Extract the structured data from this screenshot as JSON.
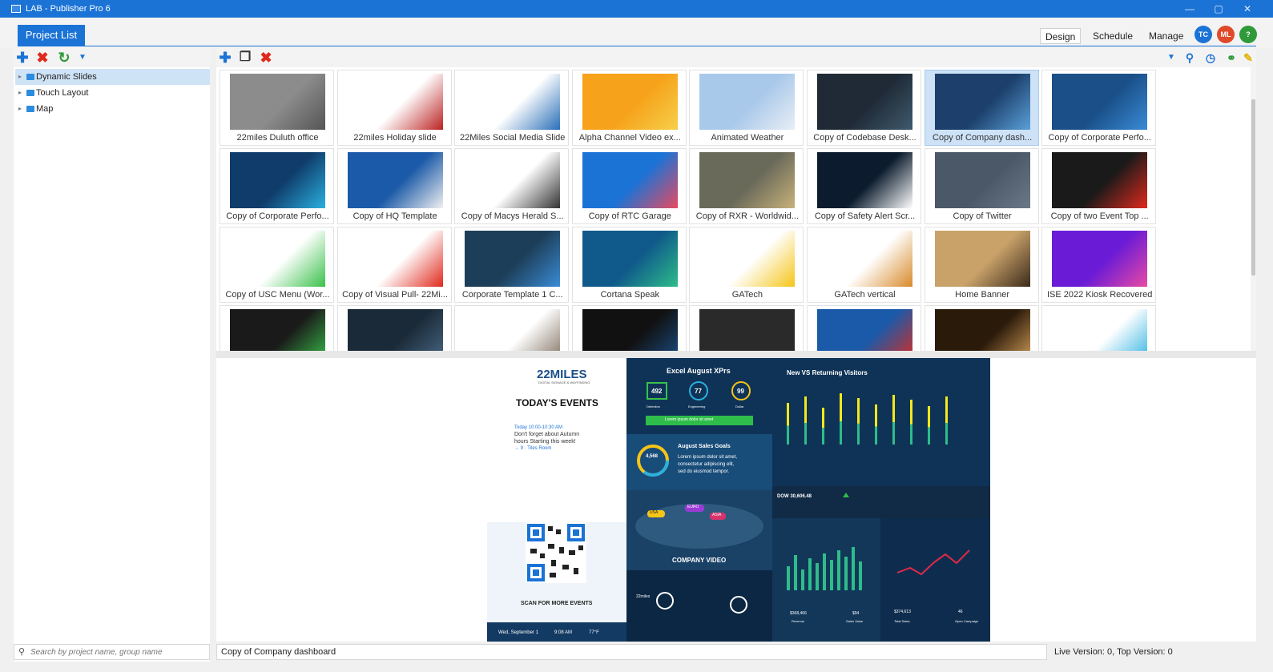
{
  "window": {
    "title": "LAB - Publisher Pro 6",
    "min": "—",
    "max": "▢",
    "close": "✕"
  },
  "topnav": {
    "project_tab": "Project List",
    "buttons": [
      {
        "label": "Design",
        "active": true
      },
      {
        "label": "Schedule"
      },
      {
        "label": "Manage"
      }
    ],
    "avatars": [
      {
        "initials": "TC",
        "color": "#1b73d6"
      },
      {
        "initials": "ML",
        "color": "#e04a2a"
      },
      {
        "initials": "?",
        "color": "#2e9a3a"
      }
    ]
  },
  "tree": {
    "items": [
      {
        "label": "Dynamic Slides",
        "selected": true
      },
      {
        "label": "Touch Layout"
      },
      {
        "label": "Map"
      }
    ]
  },
  "search": {
    "placeholder": "Search by project name, group name"
  },
  "projects": [
    {
      "name": "22miles Duluth office"
    },
    {
      "name": "22miles Holiday slide"
    },
    {
      "name": "22Miles Social Media Slide"
    },
    {
      "name": "Alpha Channel Video ex..."
    },
    {
      "name": "Animated Weather"
    },
    {
      "name": "Copy of Codebase Desk..."
    },
    {
      "name": "Copy of Company dash...",
      "selected": true
    },
    {
      "name": "Copy of Corporate Perfo..."
    },
    {
      "name": "Copy of Corporate Perfo..."
    },
    {
      "name": "Copy of HQ Template"
    },
    {
      "name": "Copy of Macys Herald S..."
    },
    {
      "name": "Copy of RTC Garage"
    },
    {
      "name": "Copy of RXR - Worldwid..."
    },
    {
      "name": "Copy of Safety Alert Scr..."
    },
    {
      "name": "Copy of Twitter"
    },
    {
      "name": "Copy of two Event Top ..."
    },
    {
      "name": "Copy of USC Menu (Wor..."
    },
    {
      "name": "Copy of Visual Pull- 22Mi..."
    },
    {
      "name": "Corporate Template 1 C..."
    },
    {
      "name": "Cortana Speak"
    },
    {
      "name": "GATech"
    },
    {
      "name": "GATech vertical"
    },
    {
      "name": "Home Banner"
    },
    {
      "name": "ISE 2022 Kiosk Recovered"
    },
    {
      "name": ""
    },
    {
      "name": ""
    },
    {
      "name": ""
    },
    {
      "name": ""
    },
    {
      "name": ""
    },
    {
      "name": ""
    },
    {
      "name": ""
    },
    {
      "name": ""
    }
  ],
  "preview": {
    "logo": "22MILES",
    "logo_sub": "DIGITAL SIGNAGE & WAYFINDING",
    "events_title": "TODAY'S EVENTS",
    "event_time": "Today 10:00-10:30 AM",
    "event_text_1": "Don't forget about Autumn",
    "event_text_2": "hours Starting this week!",
    "event_room": "→ 9 · Tiles Room",
    "scan_text": "SCAN FOR MORE EVENTS",
    "footer_date": "Wed, September 1",
    "footer_time": "9:08 AM",
    "footer_temp": "77°F",
    "xprs_title": "Excel August XPrs",
    "kpi_1": "492",
    "kpi_2": "77",
    "kpi_3": "99",
    "kpi_1_lbl": "Detection",
    "kpi_2_lbl": "Engineering",
    "kpi_3_lbl": "Dollar",
    "xprs_btn": "Lorem ipsum dolor sit amet",
    "sales_title": "August Sales Goals",
    "sales_value": "4,568",
    "sales_text_1": "Lorem ipsum dolor sit amet,",
    "sales_text_2": "consectetur adipiscing elit,",
    "sales_text_3": "sed do eiusmod tempor.",
    "map_labels": [
      "USA",
      "EURO",
      "ASIA"
    ],
    "company_video": "COMPANY VIDEO",
    "visitors_title": "New VS Returning Visitors",
    "dow": "DOW 30,606.48",
    "stat_1": "$368,466",
    "stat_1_lbl": "Revenue",
    "stat_2": "$94",
    "stat_2_lbl": "Sales Value",
    "stat_3": "$374,613",
    "stat_3_lbl": "Total Sales",
    "stat_4": "46",
    "stat_4_lbl": "Open Campaign",
    "ticker_brand": "22miles"
  },
  "status": {
    "selected_name": "Copy of Company dashboard",
    "version": "Live Version: 0, Top Version: 0"
  }
}
